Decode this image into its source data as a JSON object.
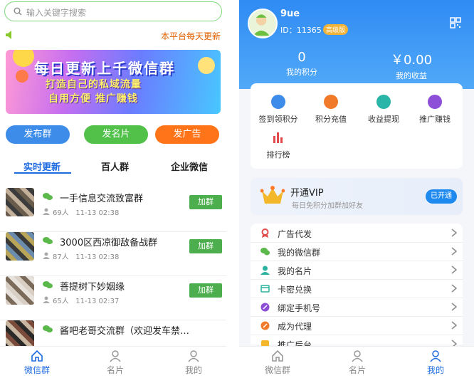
{
  "left": {
    "search_placeholder": "输入关键字搜索",
    "notice": "本平台每天更新",
    "banner": {
      "line1": "每日更新上千微信群",
      "line2": "打造自己的私域流量",
      "line3": "自用方便  推广赚钱"
    },
    "buttons": [
      "发布群",
      "发名片",
      "发广告"
    ],
    "tabs": [
      "实时更新",
      "百人群",
      "企业微信"
    ],
    "groups": [
      {
        "name": "一手信息交流致富群",
        "members": "69人",
        "time": "11-13 02:38",
        "join": "加群"
      },
      {
        "name": "3000区西凉御敌备战群",
        "members": "87人",
        "time": "11-13 02:38",
        "join": "加群"
      },
      {
        "name": "菩提树下妙姻缘",
        "members": "65人",
        "time": "11-13 02:37",
        "join": "加群"
      },
      {
        "name": "酱吧老哥交流群（欢迎发车禁…",
        "members": "",
        "time": "",
        "join": ""
      }
    ],
    "nav": [
      "微信群",
      "名片",
      "我的"
    ]
  },
  "right": {
    "username": "9ue",
    "id": "ID：11365",
    "level": "高级版",
    "points": {
      "value": "0",
      "label": "我的积分"
    },
    "income": {
      "value": "￥0.00",
      "label": "我的收益"
    },
    "functions": [
      "签到领积分",
      "积分充值",
      "收益提现",
      "推广赚钱",
      "排行榜"
    ],
    "vip": {
      "title": "开通VIP",
      "sub": "每日免积分加群加好友",
      "button": "已开通"
    },
    "menu": [
      "广告代发",
      "我的微信群",
      "我的名片",
      "卡密兑换",
      "绑定手机号",
      "成为代理",
      "推广后台"
    ],
    "nav": [
      "微信群",
      "名片",
      "我的"
    ]
  },
  "colors": {
    "primary": "#1e6be0",
    "green": "#4cae4c",
    "orange": "#ff7418"
  }
}
